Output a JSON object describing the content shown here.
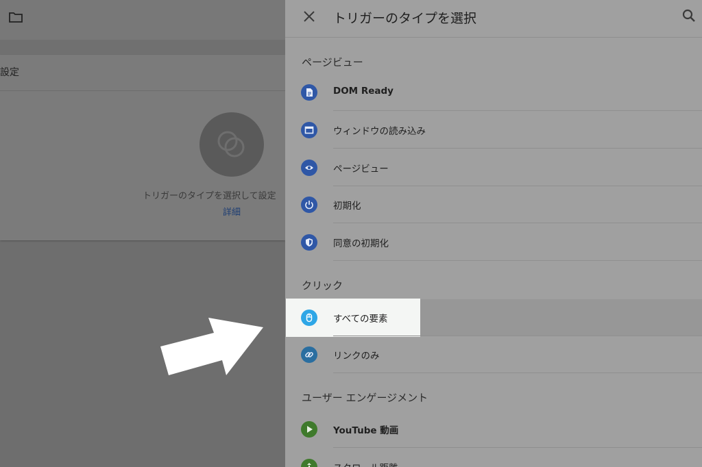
{
  "background": {
    "card_title": "設定",
    "hint_text": "トリガーのタイプを選択して設定",
    "link_text": "詳細"
  },
  "panel": {
    "title": "トリガーのタイプを選択",
    "sections": [
      {
        "title": "ページビュー",
        "items": [
          {
            "label": "DOM Ready",
            "icon": "document-icon",
            "color": "#2f57a6"
          },
          {
            "label": "ウィンドウの読み込み",
            "icon": "window-icon",
            "color": "#2f57a6"
          },
          {
            "label": "ページビュー",
            "icon": "eye-icon",
            "color": "#2f57a6"
          },
          {
            "label": "初期化",
            "icon": "power-icon",
            "color": "#2f57a6"
          },
          {
            "label": "同意の初期化",
            "icon": "shield-icon",
            "color": "#2f57a6"
          }
        ]
      },
      {
        "title": "クリック",
        "items": [
          {
            "label": "すべての要素",
            "icon": "mouse-icon",
            "color": "#2ea6e6",
            "highlighted": true
          },
          {
            "label": "リンクのみ",
            "icon": "link-icon",
            "color": "#2a6ea0"
          }
        ]
      },
      {
        "title": "ユーザー エンゲージメント",
        "items": [
          {
            "label": "YouTube 動画",
            "icon": "play-icon",
            "color": "#3f7a2c"
          },
          {
            "label": "スクロール距離",
            "icon": "scroll-icon",
            "color": "#3f7a2c"
          }
        ]
      }
    ]
  },
  "colors": {
    "overlay": "#6e6e6e",
    "panel_bg": "#a0a0a0",
    "highlight": "#f4f6f4",
    "annotation_arrow": "#ffffff"
  }
}
